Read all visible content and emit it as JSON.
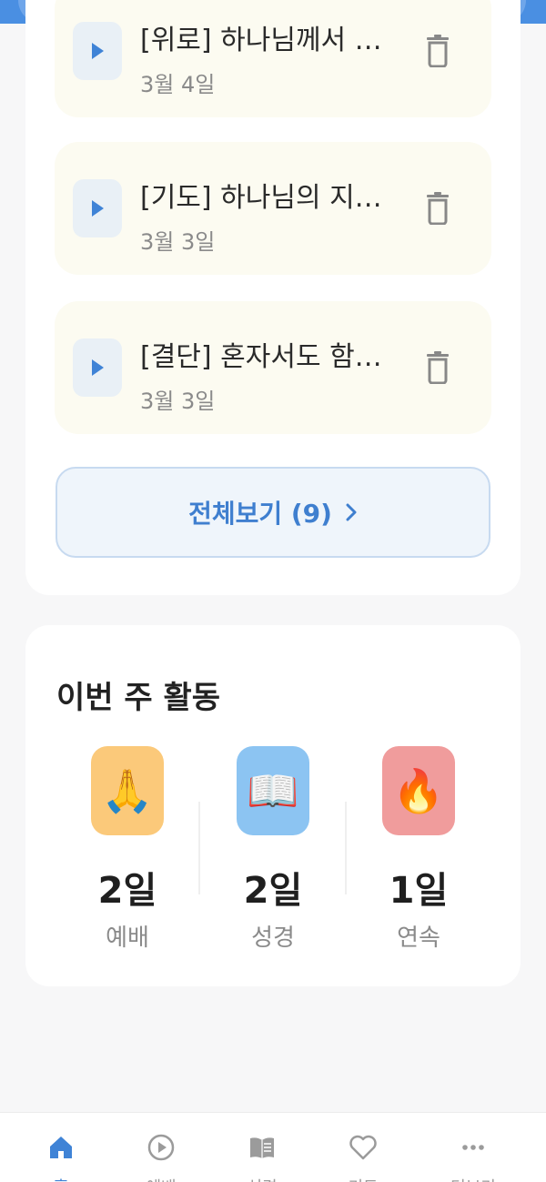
{
  "recordings": [
    {
      "title": "[위로] 하나님께서 …",
      "date": "3월 4일"
    },
    {
      "title": "[기도] 하나님의 지…",
      "date": "3월 3일"
    },
    {
      "title": "[결단] 혼자서도 함…",
      "date": "3월 3일"
    }
  ],
  "view_all": {
    "label": "전체보기 (9)"
  },
  "weekly": {
    "heading": "이번 주 활동",
    "stats": [
      {
        "emoji": "🙏",
        "value": "2일",
        "label": "예배",
        "color": "#fbc97a"
      },
      {
        "emoji": "📖",
        "value": "2일",
        "label": "성경",
        "color": "#8cc4f2"
      },
      {
        "emoji": "🔥",
        "value": "1일",
        "label": "연속",
        "color": "#f09c9c"
      }
    ]
  },
  "nav": {
    "items": [
      {
        "icon": "home-icon",
        "label": "홈",
        "active": true
      },
      {
        "icon": "play-circle-icon",
        "label": "예배",
        "active": false
      },
      {
        "icon": "book-icon",
        "label": "성경",
        "active": false
      },
      {
        "icon": "heart-icon",
        "label": "기도",
        "active": false
      },
      {
        "icon": "more-icon",
        "label": "더보기",
        "active": false
      }
    ]
  },
  "colors": {
    "accent": "#3f83d6",
    "header": "#4a8fe2",
    "record_bg": "#fcfbf1"
  }
}
